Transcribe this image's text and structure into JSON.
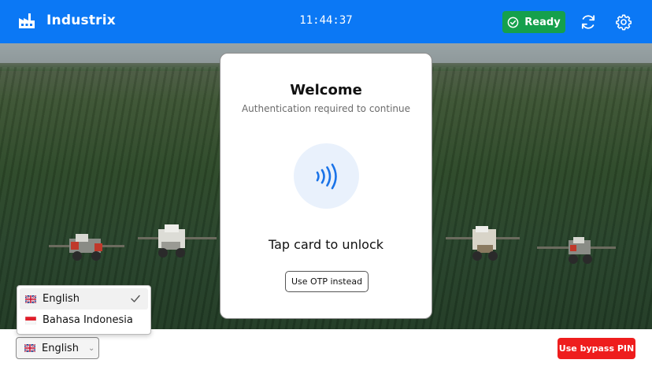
{
  "header": {
    "app_name": "Industrix",
    "clock": "11:44:37",
    "status_label": "Ready"
  },
  "card": {
    "title": "Welcome",
    "subtitle": "Authentication required to continue",
    "tap_prompt": "Tap card to unlock",
    "otp_button": "Use OTP instead"
  },
  "language": {
    "selected": "English",
    "options": [
      {
        "label": "English",
        "flag": "uk-flag-icon",
        "selected": true
      },
      {
        "label": "Bahasa Indonesia",
        "flag": "indonesia-flag-icon",
        "selected": false
      }
    ]
  },
  "footer": {
    "bypass_button": "Use bypass PIN"
  },
  "colors": {
    "header": "#0b78f5",
    "ready": "#15a04c",
    "bypass": "#ee1d1d",
    "nfc": "#1a73e8"
  },
  "icons": {
    "brand": "factory-icon",
    "status": "check-circle-icon",
    "refresh": "refresh-icon",
    "settings": "gear-icon",
    "nfc": "nfc-icon",
    "dropdown": "chevron-down-icon",
    "selected_option": "check-icon"
  }
}
